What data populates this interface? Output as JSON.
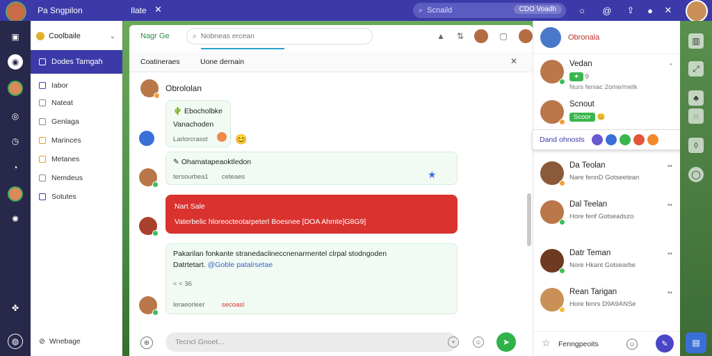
{
  "topbar": {
    "app_title": "Pa Sngpilon",
    "tab_title": "Ilate",
    "tab_close": "✕",
    "search_placeholder": "Scnaild",
    "search_chip": "CDO Voadh",
    "icons": [
      "circle-icon",
      "at-icon",
      "share-icon",
      "notification-icon",
      "close-icon"
    ]
  },
  "rail": {
    "icons": [
      "inbox-icon",
      "globe-icon",
      "avatar",
      "compass-icon",
      "clock-icon",
      "timer-icon",
      "avatar",
      "settings-icon",
      "puzzle-icon",
      "help-icon"
    ]
  },
  "nav": {
    "workspace": "Coolbaile",
    "active_item": "Dodes Tamgah",
    "items": [
      "Iabor",
      "Nateat",
      "Genlaga",
      "Marinces",
      "Metanes",
      "Nemdeus",
      "Sotutes"
    ],
    "footer": "Wnebage"
  },
  "chat": {
    "title": "Nagr Ge",
    "search_placeholder": "Nobneas ercean",
    "subtabs": [
      "Coatineraes",
      "Uone dernain"
    ],
    "conversation_name": "Obrololan",
    "messages": [
      {
        "lines": [
          "Ebocholbke",
          "Vanachoden"
        ],
        "meta": "Larlorcrasst",
        "type": "green"
      },
      {
        "lines": [
          "Ohamatapeaoktledon"
        ],
        "meta": "tersourbea1",
        "meta2": "ceteaes",
        "type": "green"
      },
      {
        "lines": [
          "Nart Sale",
          "Vaterbelic hloreocteotarpeterl Boesnee [DOA Ahmte]G8G9]"
        ],
        "type": "red"
      },
      {
        "lines": [
          "Pakarilan fonkante stranedaclineccnenarmentel clrpal stodngoden",
          "Datrtetart."
        ],
        "link": "@Goble patalrsetae",
        "meta": "< < 36",
        "type": "green"
      },
      {
        "meta": "leraeorleer",
        "meta2": "secoasl",
        "type": "green"
      }
    ],
    "composer_placeholder": "Tecncl Gnoet..."
  },
  "contacts": {
    "me_name": "Obronala",
    "list": [
      {
        "name": "Vedan",
        "sub": "9",
        "sub2": "Nurs feniac 2ome/metk"
      },
      {
        "name": "Scnout",
        "badge": "Scoor"
      },
      {
        "name": "Da Teolan",
        "sub": "Nare fennD Gotseetean"
      },
      {
        "name": "Dal Teelan",
        "sub": "Hore fenf Gotseadszo"
      },
      {
        "name": "Datr Teman",
        "sub": "Nore Hkant Gotsearbe"
      },
      {
        "name": "Rean Tarigan",
        "sub": "Hore fenrs D9A9ANSe"
      }
    ],
    "react_label": "Dand ohnosts",
    "bottom_label": "Fenngpeoits"
  },
  "colors": {
    "primary": "#3b3aa8",
    "send": "#2fb24a",
    "alert": "#d9322f"
  }
}
